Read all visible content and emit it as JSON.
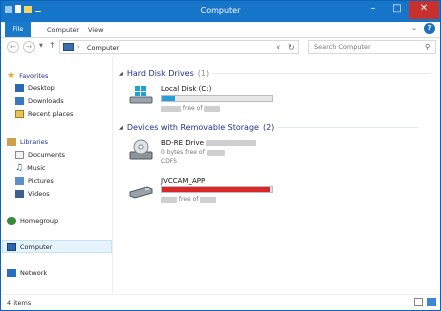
{
  "window": {
    "title": "Computer"
  },
  "ribbon": {
    "tabs": [
      "File",
      "Computer",
      "View"
    ],
    "expand_glyph": "⌄",
    "help_glyph": "?"
  },
  "address": {
    "location": "Computer",
    "back_glyph": "←",
    "forward_glyph": "→",
    "up_glyph": "↑",
    "refresh_glyph": "↻",
    "dropdown_glyph": "∨"
  },
  "search": {
    "placeholder": "Search Computer"
  },
  "navigation": {
    "favorites": {
      "label": "Favorites",
      "items": [
        "Desktop",
        "Downloads",
        "Recent places"
      ]
    },
    "libraries": {
      "label": "Libraries",
      "items": [
        "Documents",
        "Music",
        "Pictures",
        "Videos"
      ]
    },
    "homegroup": "Homegroup",
    "computer": "Computer",
    "network": "Network"
  },
  "groups": {
    "hard_disk": {
      "label": "Hard Disk Drives",
      "count": "(1)"
    },
    "removable": {
      "label": "Devices with Removable Storage",
      "count": "(2)"
    }
  },
  "drives": [
    {
      "name": "Local Disk (C:)",
      "free_text": "free of",
      "usage": 0.12,
      "bar_color": "#26a0da"
    },
    {
      "name": "BD-RE Drive",
      "free_line": "0 bytes free of",
      "filesystem": "CDFS"
    },
    {
      "name": "JVCCAM_APP",
      "free_text": "free of",
      "usage": 0.98,
      "bar_color": "#da2626"
    }
  ],
  "status": {
    "items": "4 items"
  },
  "colors": {
    "accent": "#1675c9",
    "close": "#c7302c",
    "group_header": "#1e3287"
  },
  "icons": [
    "favorites-star-icon",
    "desktop-icon",
    "downloads-icon",
    "recent-places-icon",
    "libraries-icon",
    "documents-icon",
    "music-icon",
    "pictures-icon",
    "videos-icon",
    "homegroup-icon",
    "computer-icon",
    "network-icon",
    "windows-drive-icon",
    "optical-drive-icon",
    "removable-drive-icon"
  ]
}
